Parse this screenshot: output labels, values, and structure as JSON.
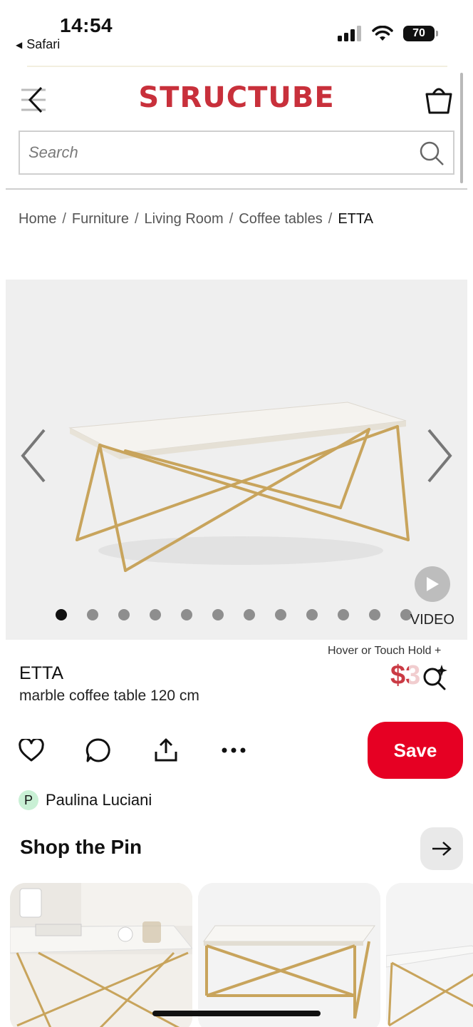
{
  "status_bar": {
    "time": "14:54",
    "back_app": "Safari",
    "battery": "70"
  },
  "site": {
    "logo": "STRUCTUBE",
    "search_placeholder": "Search",
    "breadcrumb": [
      "Home",
      "Furniture",
      "Living Room",
      "Coffee tables"
    ],
    "breadcrumb_current": "ETTA",
    "video_label": "VIDEO",
    "carousel_total": 12,
    "carousel_active": 1
  },
  "overlay": {
    "hover_hint": "Hover or Touch Hold +"
  },
  "product": {
    "name": "ETTA",
    "description": "marble coffee table 120 cm",
    "price_visible": "$3"
  },
  "actions": {
    "save_label": "Save"
  },
  "creator": {
    "initial": "P",
    "name": "Paulina Luciani"
  },
  "shop": {
    "title": "Shop the Pin"
  },
  "colors": {
    "brand_red": "#c8303b",
    "save_red": "#e60023",
    "avatar_green": "#c9f0d5"
  }
}
